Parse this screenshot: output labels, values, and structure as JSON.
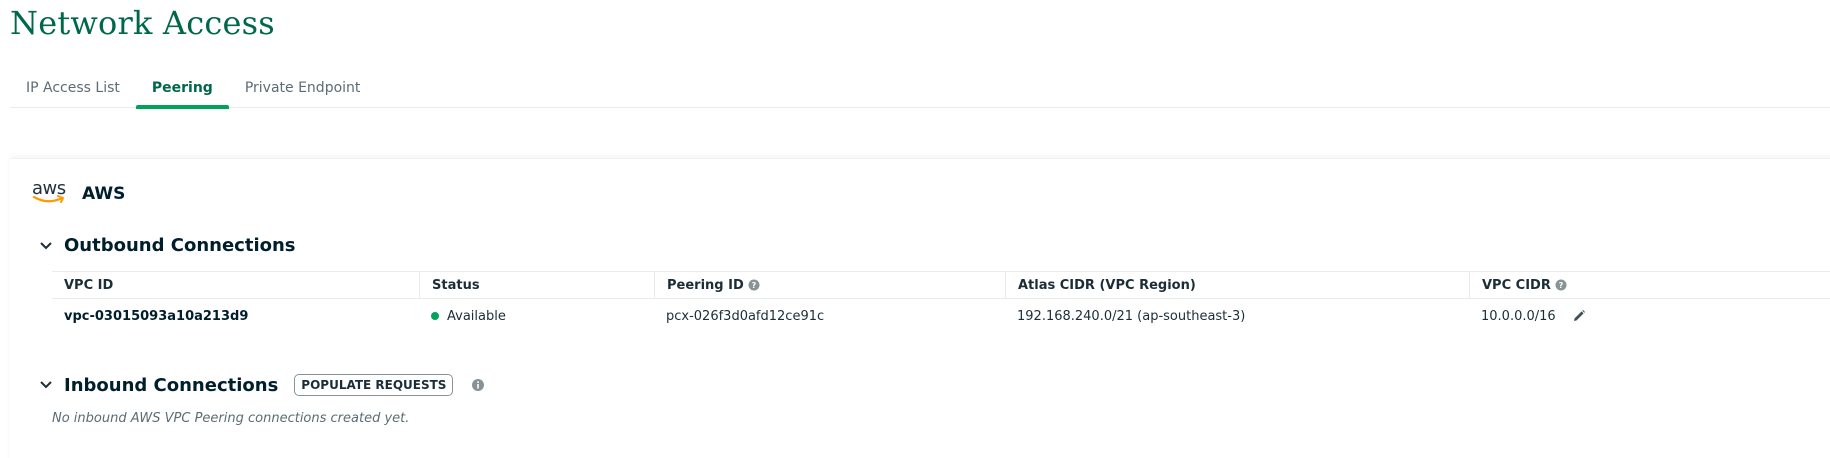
{
  "page": {
    "title": "Network Access"
  },
  "tabs": [
    {
      "label": "IP Access List",
      "active": false
    },
    {
      "label": "Peering",
      "active": true
    },
    {
      "label": "Private Endpoint",
      "active": false
    }
  ],
  "provider": {
    "logo_text": "aws",
    "name": "AWS"
  },
  "outbound": {
    "title": "Outbound Connections",
    "columns": [
      "VPC ID",
      "Status",
      "Peering ID",
      "Atlas CIDR (VPC Region)",
      "VPC CIDR"
    ],
    "rows": [
      {
        "vpc_id": "vpc-03015093a10a213d9",
        "status": "Available",
        "peering_id": "pcx-026f3d0afd12ce91c",
        "atlas_cidr": "192.168.240.0/21 (ap-southeast-3)",
        "vpc_cidr": "10.0.0.0/16"
      }
    ]
  },
  "inbound": {
    "title": "Inbound Connections",
    "populate_button": "POPULATE REQUESTS",
    "empty_message": "No inbound AWS VPC Peering connections created yet."
  },
  "colors": {
    "accent": "#00684a",
    "tab_underline": "#00a35c",
    "status_available": "#00a35c"
  }
}
